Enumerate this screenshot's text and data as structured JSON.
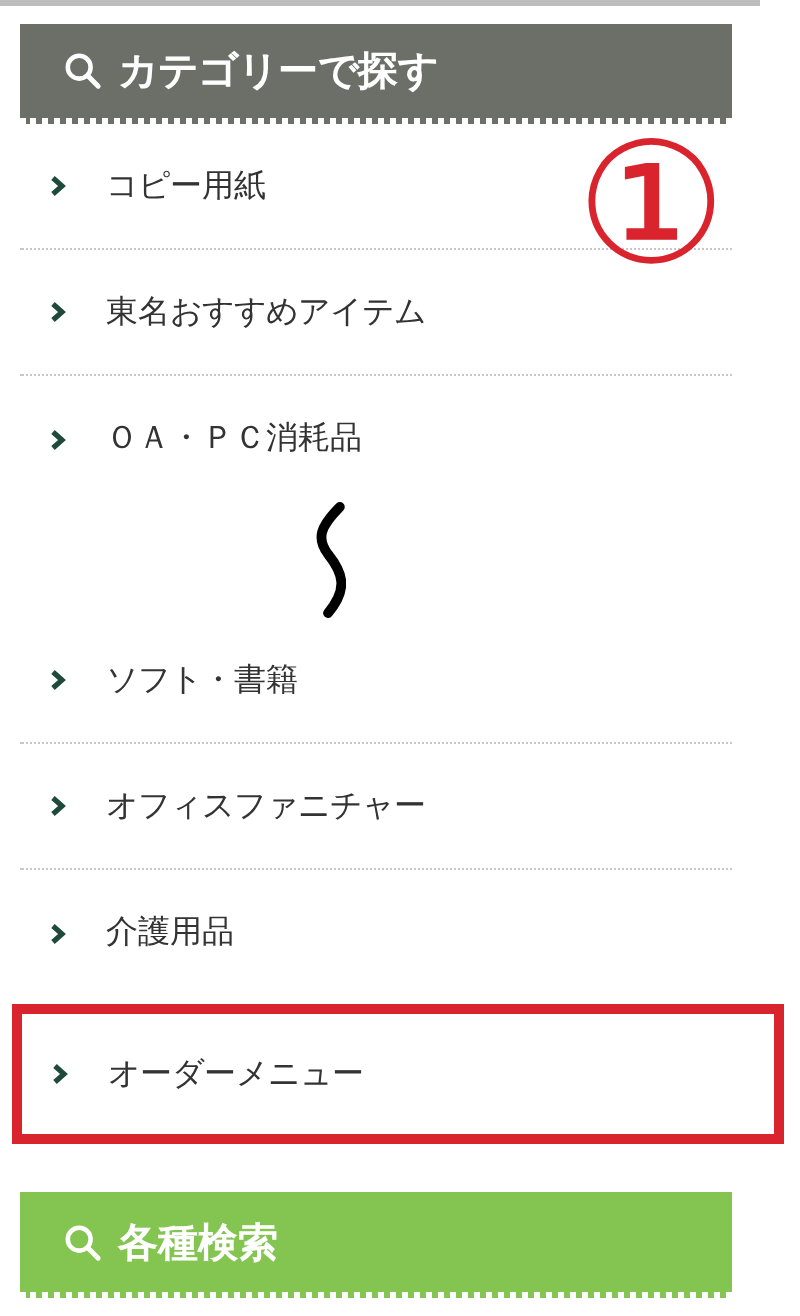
{
  "category_panel": {
    "title": "カテゴリーで探す",
    "items": [
      {
        "kind": "item",
        "label": "コピー用紙",
        "highlighted": false
      },
      {
        "kind": "item",
        "label": "東名おすすめアイテム",
        "highlighted": false
      },
      {
        "kind": "item",
        "label": "ＯＡ・ＰＣ消耗品",
        "highlighted": false
      },
      {
        "kind": "cut"
      },
      {
        "kind": "item",
        "label": "ソフト・書籍",
        "highlighted": false
      },
      {
        "kind": "item",
        "label": "オフィスファニチャー",
        "highlighted": false
      },
      {
        "kind": "item",
        "label": "介護用品",
        "highlighted": false
      },
      {
        "kind": "item",
        "label": "オーダーメニュー",
        "highlighted": true
      }
    ]
  },
  "annotation": {
    "label": "①"
  },
  "search_panel": {
    "title": "各種検索"
  }
}
